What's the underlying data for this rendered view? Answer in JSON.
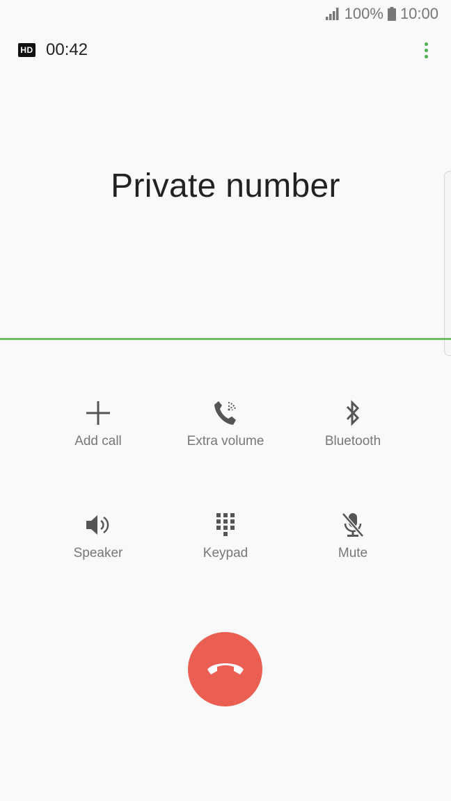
{
  "status_bar": {
    "battery": "100%",
    "time": "10:00",
    "icons": [
      "signal-icon",
      "battery-icon"
    ]
  },
  "call": {
    "hd_label": "HD",
    "timer": "00:42",
    "caller": "Private number"
  },
  "actions": {
    "add_call": "Add call",
    "extra_volume": "Extra volume",
    "bluetooth": "Bluetooth",
    "speaker": "Speaker",
    "keypad": "Keypad",
    "mute": "Mute"
  },
  "colors": {
    "accent_green": "#6dbf5e",
    "end_call_red": "#ea5f52",
    "icon_gray": "#555555"
  }
}
